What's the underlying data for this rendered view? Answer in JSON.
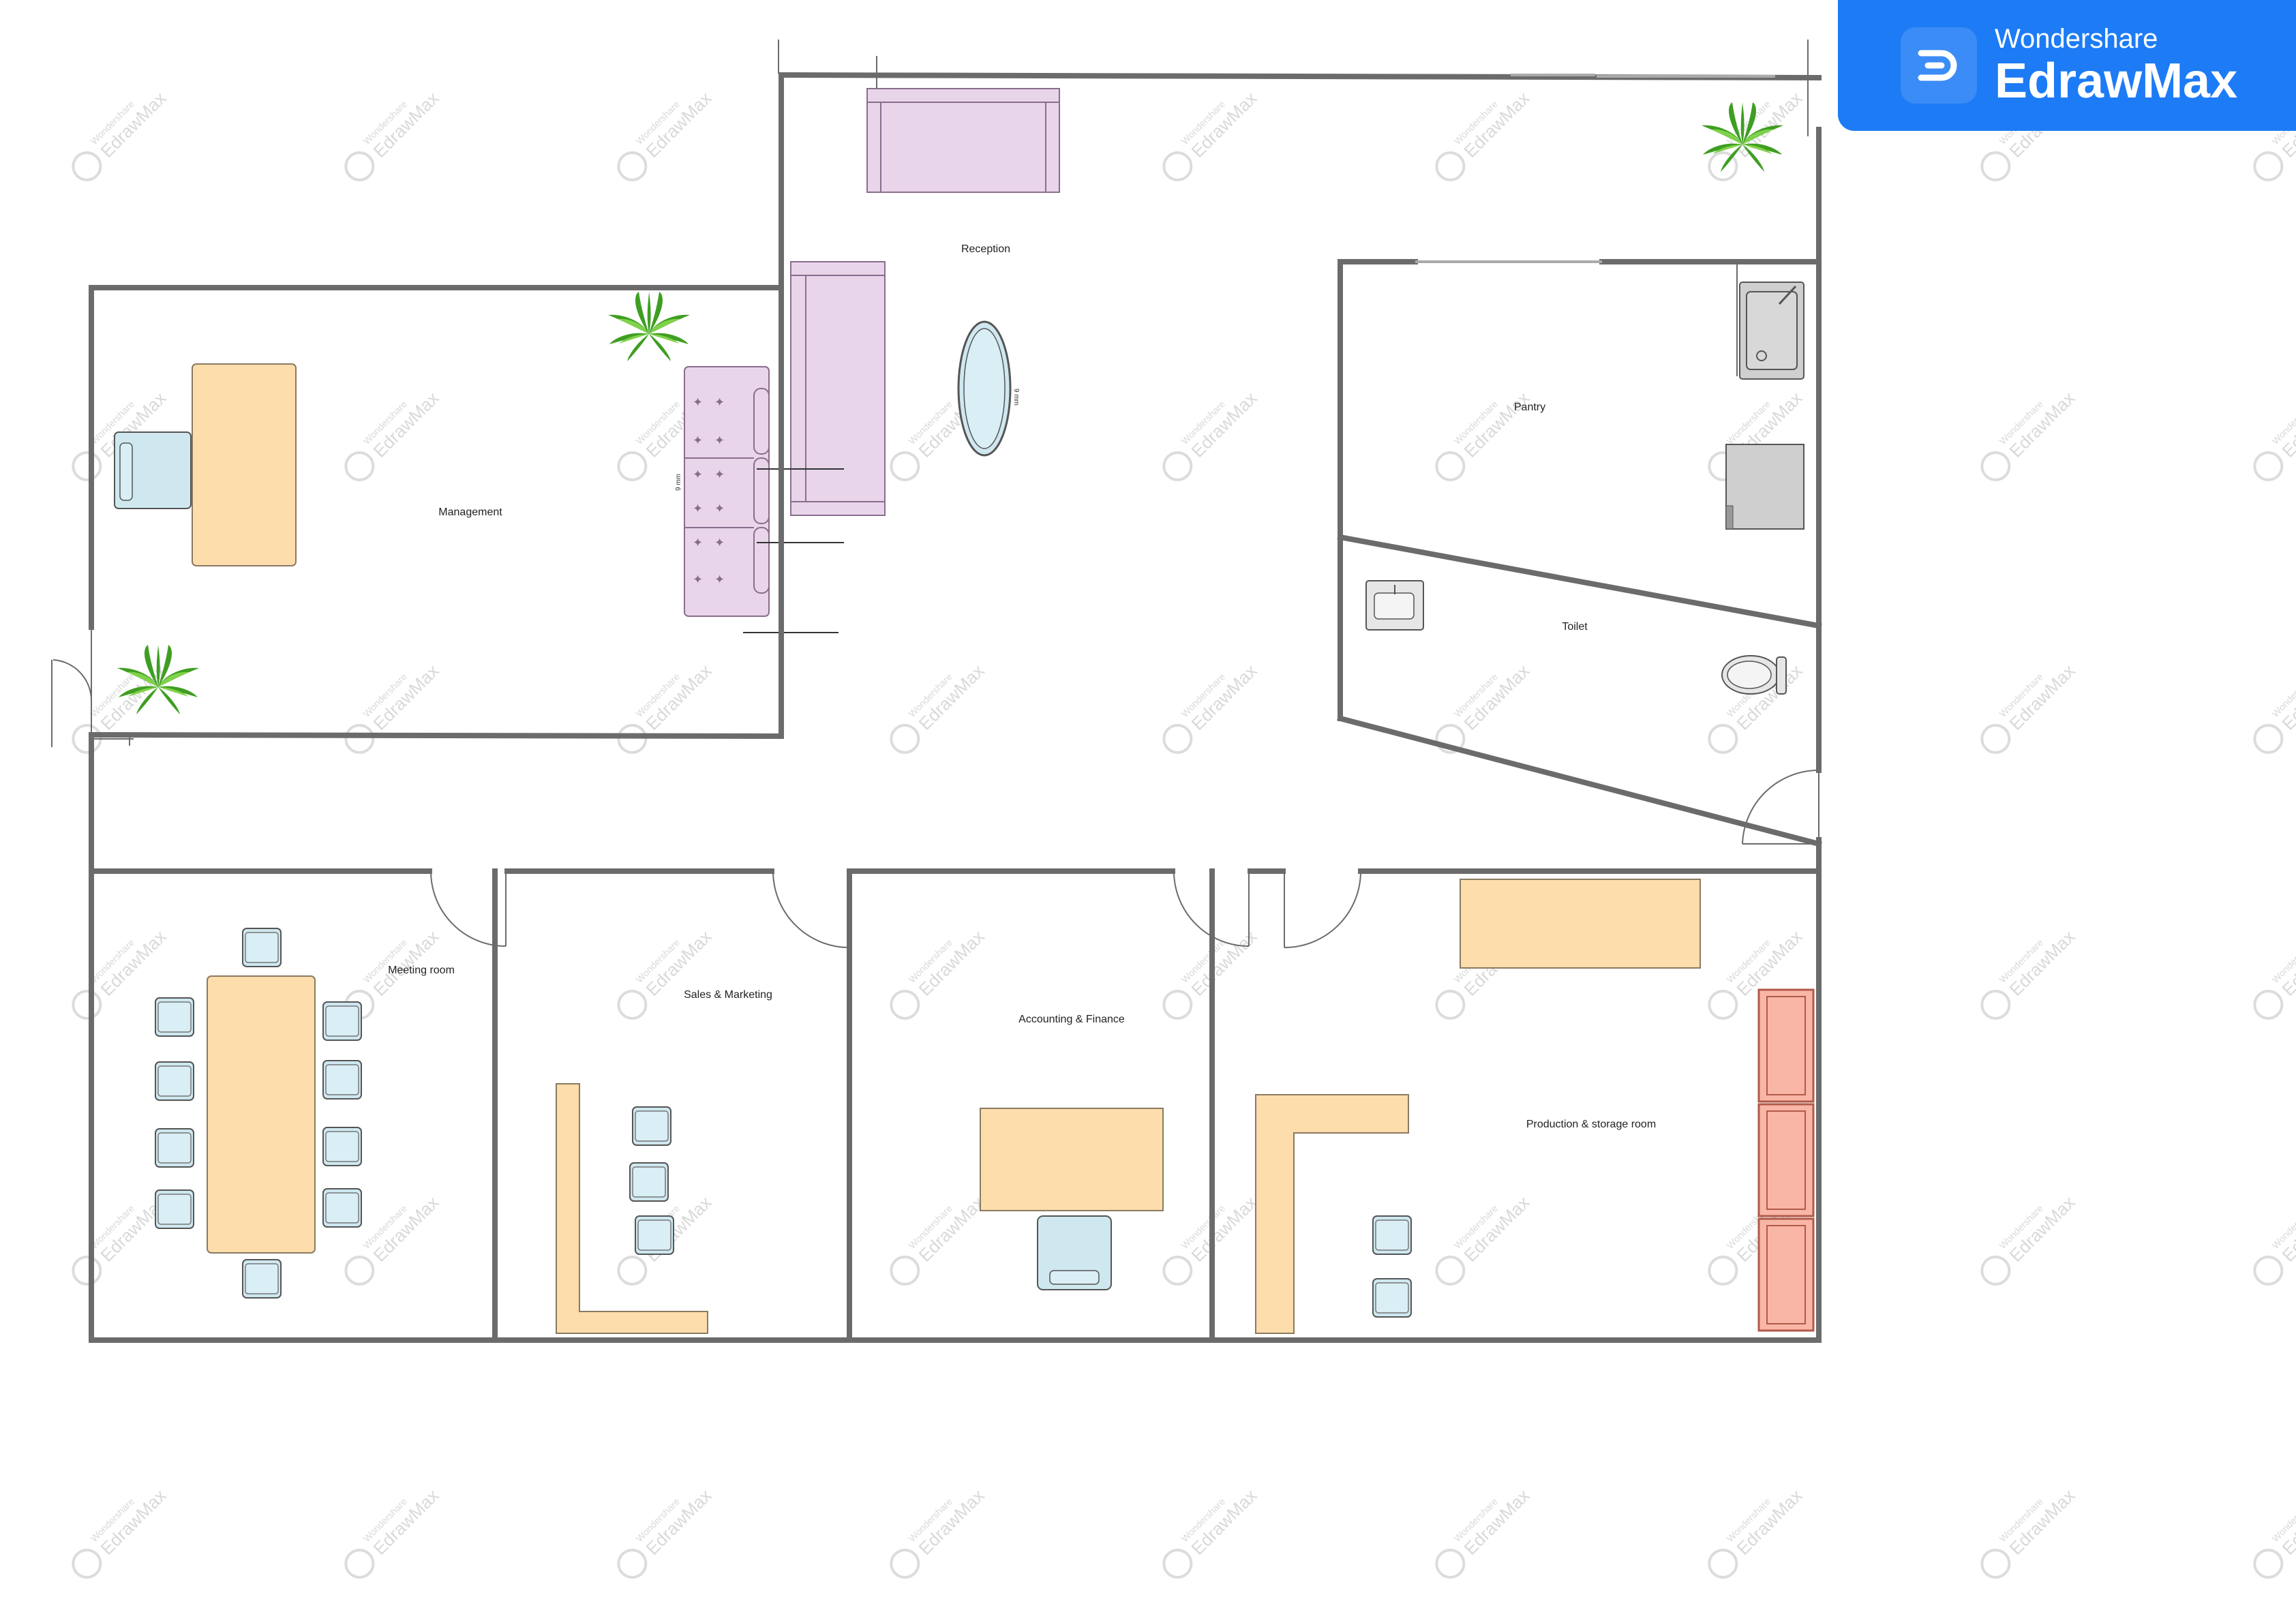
{
  "diagram": {
    "rooms": [
      {
        "key": "reception",
        "label": "Reception"
      },
      {
        "key": "management",
        "label": "Management"
      },
      {
        "key": "pantry",
        "label": "Pantry"
      },
      {
        "key": "toilet",
        "label": "Toilet"
      },
      {
        "key": "meeting",
        "label": "Meeting room"
      },
      {
        "key": "sales",
        "label": "Sales & Marketing"
      },
      {
        "key": "accounting",
        "label": "Accounting & Finance"
      },
      {
        "key": "production",
        "label": "Production & storage room"
      }
    ],
    "dimension_label": "9 mm"
  },
  "watermark": {
    "line1": "Wondershare",
    "line2": "EdrawMax"
  },
  "badge": {
    "brand": "Wondershare",
    "product": "EdrawMax"
  },
  "colors": {
    "wall": "#6b6b6b",
    "sofa": "#e8d5ea",
    "sofa_outline": "#8a6d8d",
    "desk": "#fdddab",
    "desk_outline": "#8a7a62",
    "chair": "#cfe8f0",
    "chair_outline": "#555555",
    "shelf": "#f9b6a6",
    "shelf_outline": "#b05a4a",
    "appliance": "#cfcfcf",
    "plant": "#57b52e",
    "badge_bg": "#1d7bf5"
  }
}
